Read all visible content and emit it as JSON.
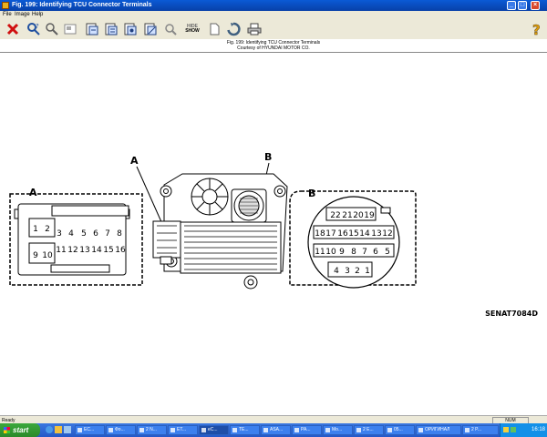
{
  "window": {
    "title": "Fig. 199: Identifying TCU Connector Terminals"
  },
  "menu": [
    "File",
    "Image",
    "Help"
  ],
  "toolbar": {
    "hide_show_top": "HIDE",
    "hide_show_bottom": "SHOW"
  },
  "header": {
    "line1": "Fig. 199: Identifying TCU Connector Terminals",
    "line2": "Courtesy of HYUNDAI MOTOR CO."
  },
  "diagram": {
    "label_a": "A",
    "label_b": "B",
    "connector_a": {
      "row1": [
        "1",
        "2",
        "3",
        "4",
        "5",
        "6",
        "7",
        "8"
      ],
      "row2": [
        "9",
        "10",
        "11",
        "12",
        "13",
        "14",
        "15",
        "16"
      ]
    },
    "connector_b": {
      "row1": [
        "22",
        "21",
        "20",
        "19"
      ],
      "row2": [
        "18",
        "17",
        "16",
        "15",
        "14",
        "13",
        "12"
      ],
      "row3": [
        "11",
        "10",
        "9",
        "8",
        "7",
        "6",
        "5"
      ],
      "row4": [
        "4",
        "3",
        "2",
        "1"
      ]
    },
    "code": "SENAT7084D"
  },
  "status": {
    "left": "Ready",
    "num": "NUM"
  },
  "taskbar": {
    "start": "start",
    "items": [
      "EC...",
      "Фо...",
      "2 N...",
      "ET...",
      "eC...",
      "TE...",
      "ASA...",
      "PA...",
      "Mo...",
      "2 E...",
      "05...",
      "ОРИГИНАЛ",
      "2 P..."
    ],
    "clock": "16:18"
  }
}
